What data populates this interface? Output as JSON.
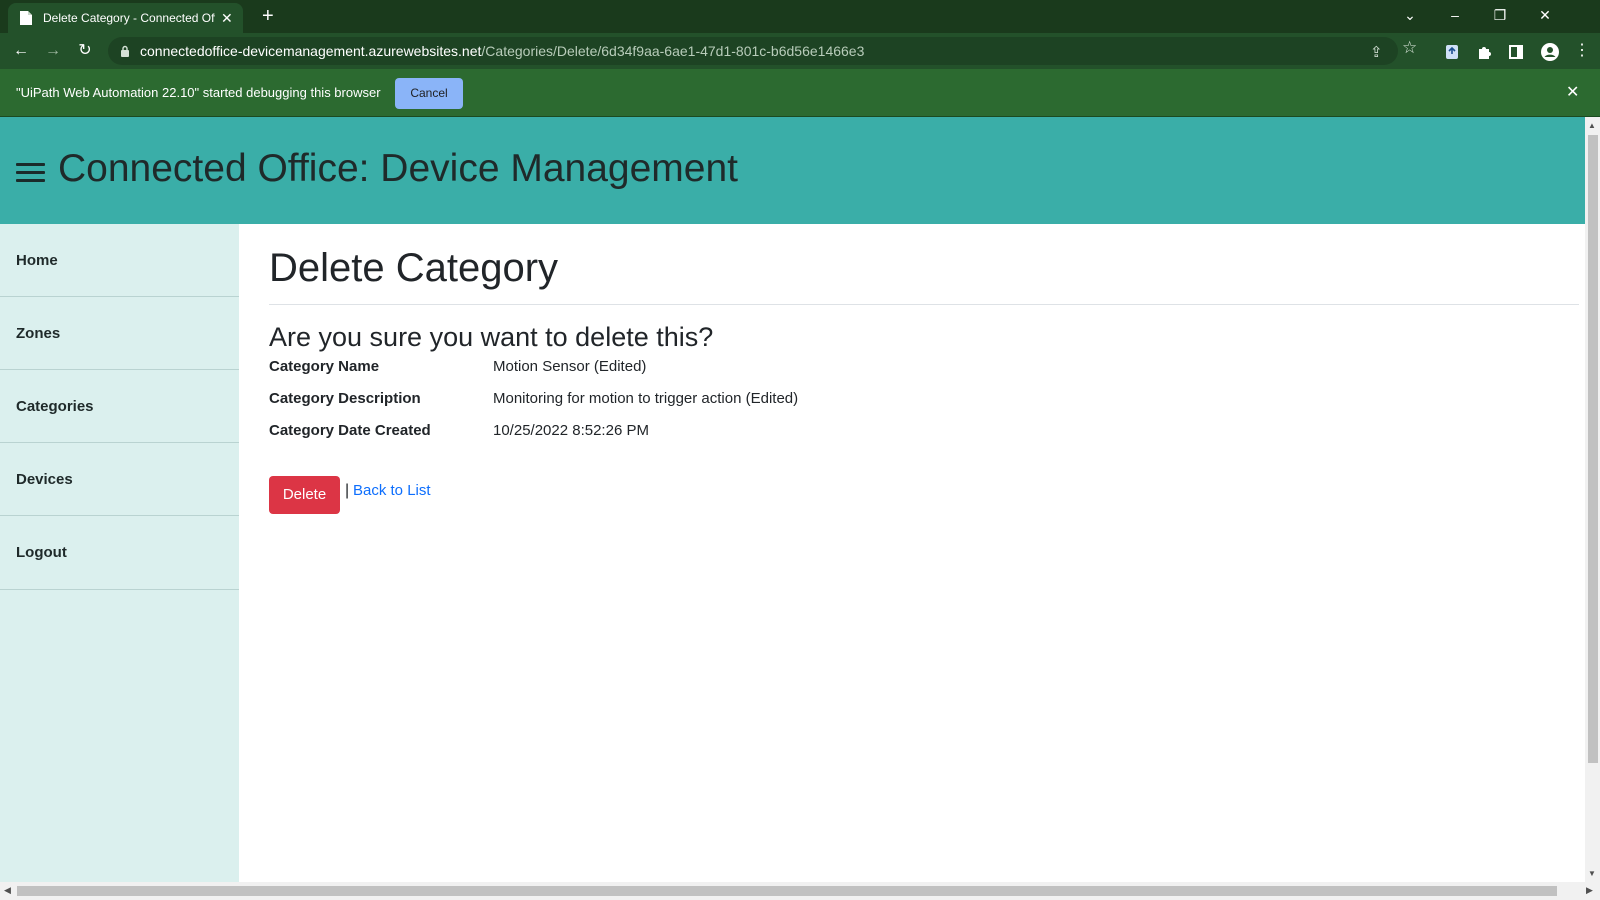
{
  "browser": {
    "tab_title": "Delete Category - Connected Off",
    "url_host": "connectedoffice-devicemanagement.azurewebsites.net",
    "url_path": "/Categories/Delete/6d34f9aa-6ae1-47d1-801c-b6d56e1466e3"
  },
  "infobar": {
    "message": "\"UiPath Web Automation 22.10\" started debugging this browser",
    "cancel_label": "Cancel"
  },
  "site": {
    "title": "Connected Office: Device Management"
  },
  "sidebar": {
    "items": [
      {
        "label": "Home"
      },
      {
        "label": "Zones"
      },
      {
        "label": "Categories"
      },
      {
        "label": "Devices"
      },
      {
        "label": "Logout"
      }
    ]
  },
  "page": {
    "heading": "Delete Category",
    "question": "Are you sure you want to delete this?",
    "details": [
      {
        "label": "Category Name",
        "value": "Motion Sensor (Edited)"
      },
      {
        "label": "Category Description",
        "value": "Monitoring for motion to trigger action (Edited)"
      },
      {
        "label": "Category Date Created",
        "value": "10/25/2022 8:52:26 PM"
      }
    ],
    "delete_label": "Delete",
    "separator": "|",
    "back_label": "Back to List"
  },
  "colors": {
    "header_bg": "#3aaea8",
    "sidebar_bg": "#dbf0ee",
    "delete_button": "#dc3545",
    "link": "#0d6efd",
    "browser_frame": "#23512a"
  }
}
